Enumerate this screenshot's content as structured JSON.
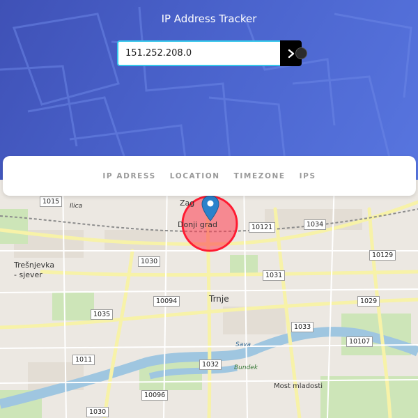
{
  "header": {
    "title": "IP Address Tracker",
    "search": {
      "value": "151.252.208.0",
      "placeholder": ""
    },
    "search_button_icon": "chevron-right-icon",
    "background_color": "#4a5fc8"
  },
  "info_panel": {
    "labels": [
      "IP ADRESS",
      "LOCATION",
      "TIMEZONE",
      "IPS"
    ]
  },
  "map": {
    "accent_color": "#ff3b4f",
    "marker_color": "#2b82cb",
    "places": {
      "zagreb": "Zag",
      "donji_grad": "Donji grad",
      "tresnjevka": "Trešnjevka\n- sjever",
      "trnje": "Trnje",
      "sava": "Sava",
      "bundek": "Bundek",
      "most_mladosti": "Most mladosti",
      "ilica": "Ilica"
    },
    "roads": [
      "1015",
      "10121",
      "1034",
      "10129",
      "1030",
      "1031",
      "10094",
      "1029",
      "1035",
      "1033",
      "10107",
      "1011",
      "1032",
      "10096",
      "1030"
    ]
  }
}
